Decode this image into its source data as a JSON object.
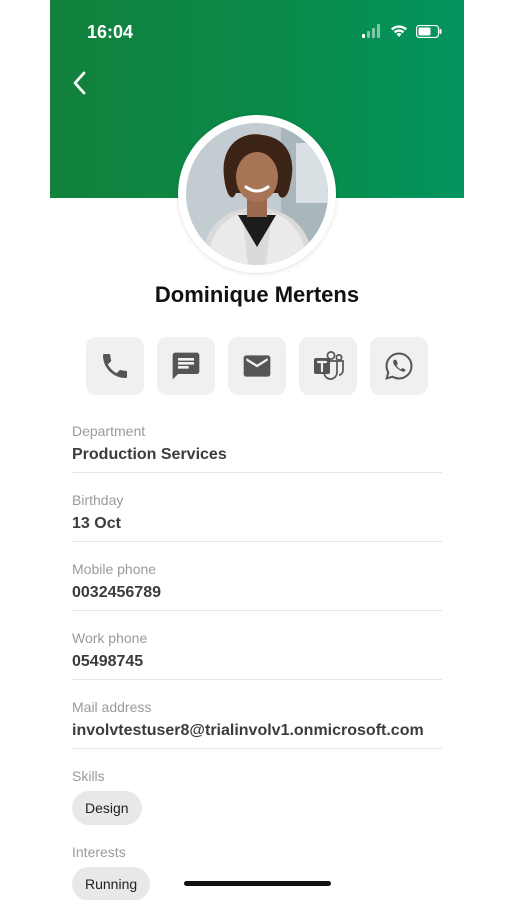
{
  "status_bar": {
    "time": "16:04"
  },
  "profile": {
    "name": "Dominique Mertens"
  },
  "actions": [
    {
      "icon": "phone-icon"
    },
    {
      "icon": "message-icon"
    },
    {
      "icon": "mail-icon"
    },
    {
      "icon": "teams-icon"
    },
    {
      "icon": "whatsapp-icon"
    }
  ],
  "fields": {
    "department": {
      "label": "Department",
      "value": "Production Services"
    },
    "birthday": {
      "label": "Birthday",
      "value": "13 Oct"
    },
    "mobile_phone": {
      "label": "Mobile phone",
      "value": "0032456789"
    },
    "work_phone": {
      "label": "Work phone",
      "value": "05498745"
    },
    "mail_address": {
      "label": "Mail address",
      "value": "involvtestuser8@trialinvolv1.onmicrosoft.com"
    }
  },
  "skills": {
    "label": "Skills",
    "items": [
      "Design"
    ]
  },
  "interests": {
    "label": "Interests",
    "items": [
      "Running"
    ]
  },
  "colors": {
    "header_start": "#12813c",
    "header_end": "#03955f",
    "chip_bg": "#e8e8e8"
  }
}
